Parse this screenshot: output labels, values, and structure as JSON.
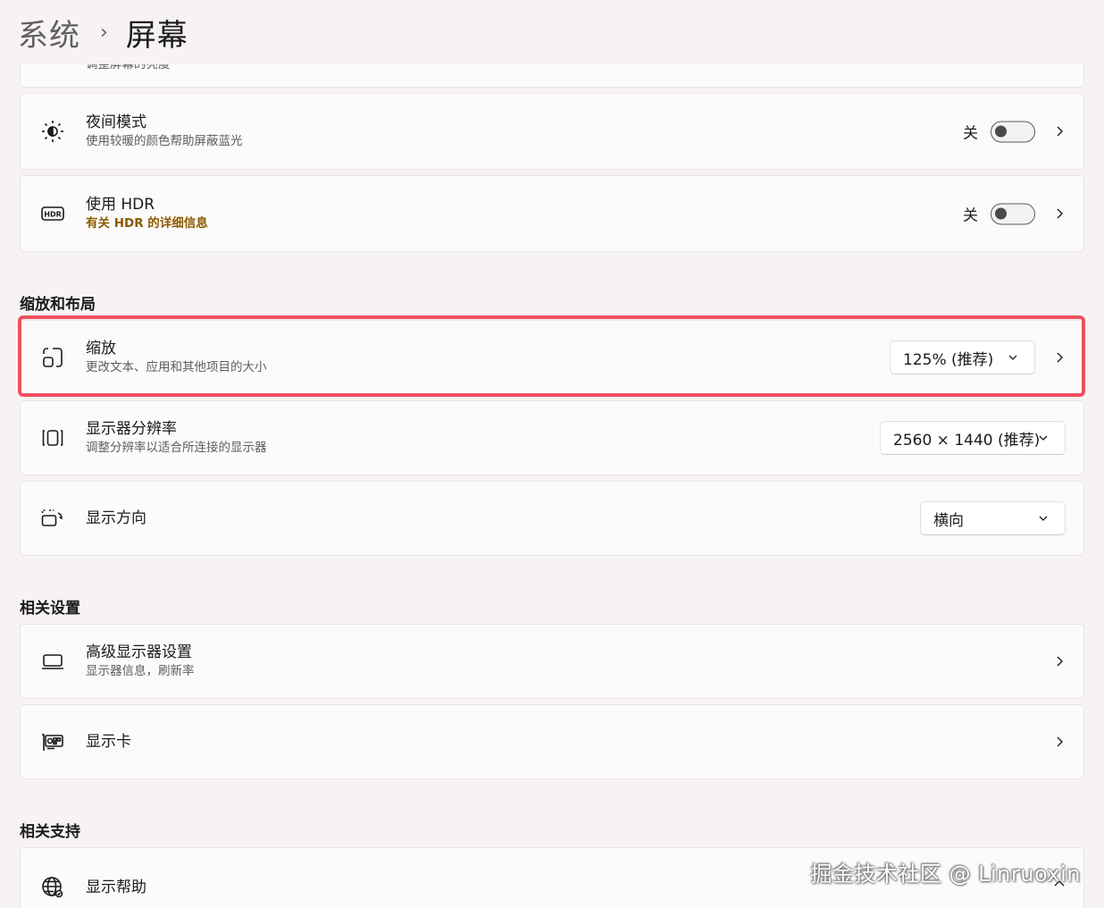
{
  "breadcrumb": {
    "parent": "系统",
    "separator": "›",
    "current": "屏幕"
  },
  "partial_card": {
    "sub": "调整屏幕的亮度"
  },
  "night_mode": {
    "title": "夜间模式",
    "sub": "使用较暖的颜色帮助屏蔽蓝光",
    "toggle_label": "关",
    "icon": "sun-moon-icon"
  },
  "hdr": {
    "title": "使用 HDR",
    "sub_link": "有关 HDR 的详细信息",
    "toggle_label": "关",
    "icon": "hdr-icon"
  },
  "section_scale": "缩放和布局",
  "scale": {
    "title": "缩放",
    "sub": "更改文本、应用和其他项目的大小",
    "value": "125% (推荐)",
    "icon": "scale-icon"
  },
  "resolution": {
    "title": "显示器分辨率",
    "sub": "调整分辨率以适合所连接的显示器",
    "value": "2560 × 1440 (推荐)",
    "icon": "resolution-icon"
  },
  "orientation": {
    "title": "显示方向",
    "value": "横向",
    "icon": "orientation-icon"
  },
  "section_related": "相关设置",
  "advanced": {
    "title": "高级显示器设置",
    "sub": "显示器信息，刷新率",
    "icon": "monitor-icon"
  },
  "gpu": {
    "title": "显示卡",
    "icon": "graphics-card-icon"
  },
  "section_support": "相关支持",
  "help": {
    "title": "显示帮助",
    "icon": "globe-icon"
  },
  "watermark": "掘金技术社区 @ Linruoxin",
  "colors": {
    "background": "#f7f3f2",
    "card": "#fcfbfb",
    "highlight": "#ee5061",
    "link": "#8a5b00"
  }
}
